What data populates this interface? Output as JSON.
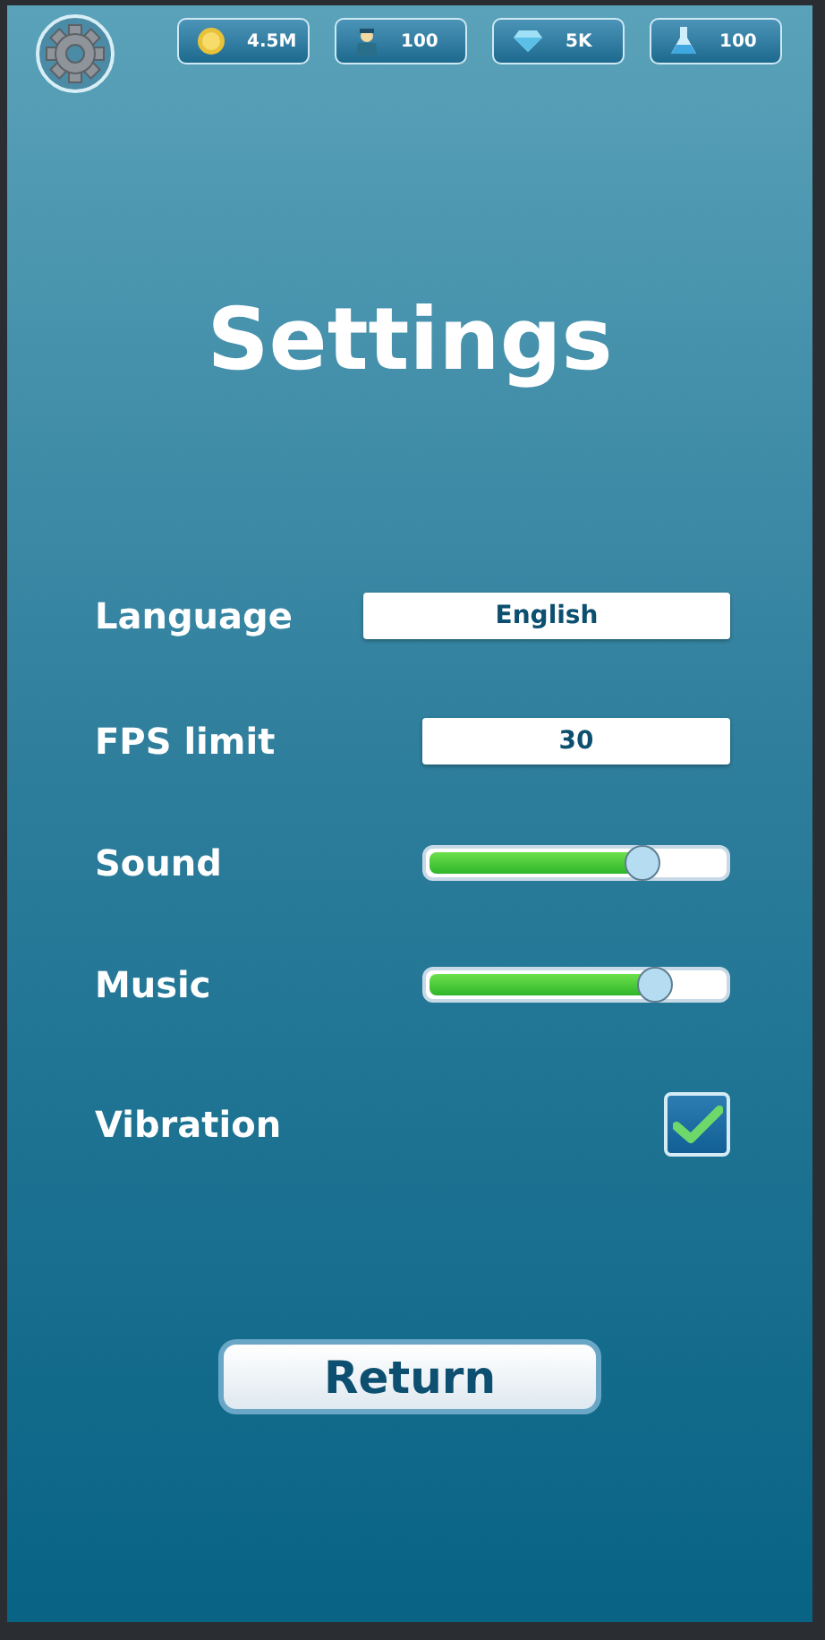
{
  "resources": [
    {
      "kind": "coin",
      "value": "4.5M"
    },
    {
      "kind": "worker",
      "value": "100"
    },
    {
      "kind": "gem",
      "value": "5K"
    },
    {
      "kind": "flask",
      "value": "100"
    }
  ],
  "title": "Settings",
  "settings": [
    {
      "kind": "field",
      "label": "Language",
      "value": "English"
    },
    {
      "kind": "field",
      "label": "FPS limit",
      "value": "30"
    },
    {
      "kind": "slider",
      "label": "Sound",
      "level": 0.72
    },
    {
      "kind": "slider",
      "label": "Music",
      "level": 0.76
    },
    {
      "kind": "checkbox",
      "label": "Vibration",
      "checked": true
    }
  ],
  "return_button": "Return"
}
